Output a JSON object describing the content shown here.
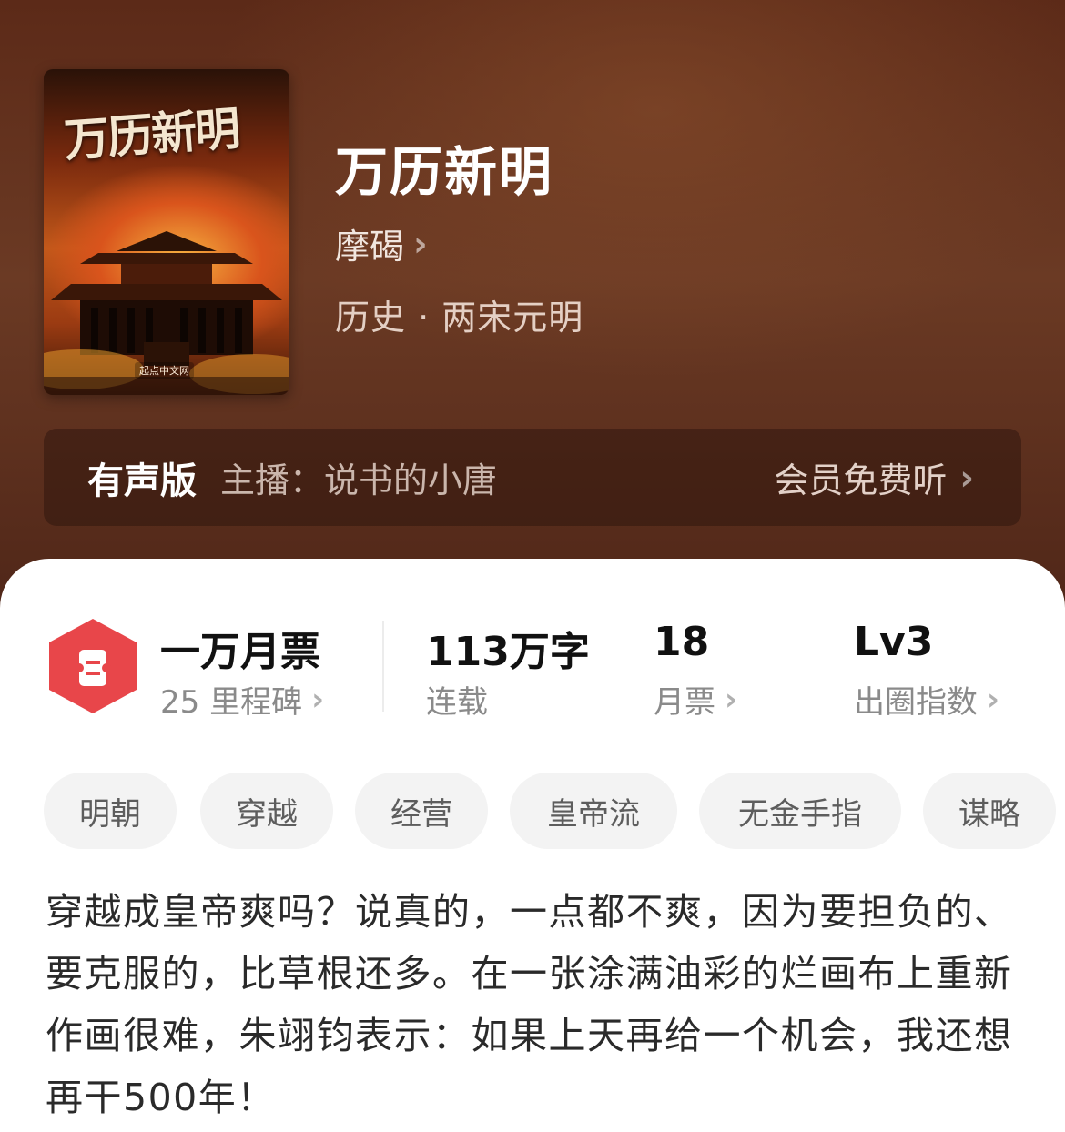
{
  "book": {
    "cover_title": "万历新明",
    "cover_publisher": "起点中文网",
    "title": "万历新明",
    "author": "摩碣",
    "category": "历史 · 两宋元明"
  },
  "audio": {
    "label": "有声版",
    "host": "主播：说书的小唐",
    "action": "会员免费听"
  },
  "stats": {
    "monthly_ticket_title": "一万月票",
    "milestone": "25 里程碑",
    "word_count": "113万字",
    "status": "连载",
    "monthly_votes": "18",
    "monthly_votes_label": "月票",
    "level": "Lv3",
    "level_label": "出圈指数"
  },
  "tags": [
    "明朝",
    "穿越",
    "经营",
    "皇帝流",
    "无金手指",
    "谋略"
  ],
  "description": "穿越成皇帝爽吗？说真的，一点都不爽，因为要担负的、要克服的，比草根还多。在一张涂满油彩的烂画布上重新作画很难，朱翊钧表示：如果上天再给一个机会，我还想再干500年！",
  "colors": {
    "hero_bg": "#5c2a18",
    "ticket_icon": "#e8464a",
    "tag_bg": "#f3f3f3"
  }
}
